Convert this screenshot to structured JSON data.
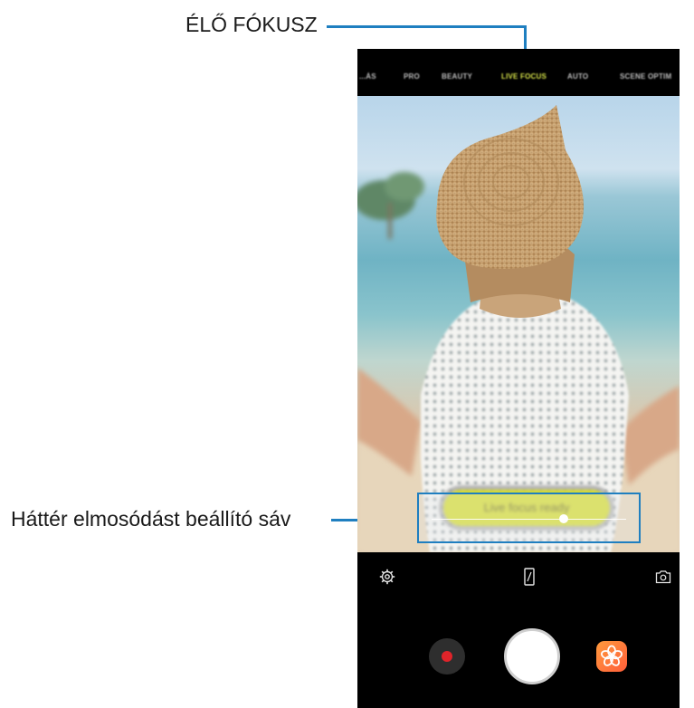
{
  "callouts": {
    "live_focus": "ÉLŐ FÓKUSZ",
    "blur_bar": "Háttér elmosódást beállító sáv"
  },
  "camera": {
    "modes": [
      {
        "label": "...ÁS",
        "active": false
      },
      {
        "label": "PRO",
        "active": false
      },
      {
        "label": "BEAUTY",
        "active": false
      },
      {
        "label": "LIVE FOCUS",
        "active": true
      },
      {
        "label": "AUTO",
        "active": false
      },
      {
        "label": "SCENE OPTIM",
        "active": false
      }
    ],
    "live_focus_status": "Live focus ready",
    "blur_level": 0.68,
    "icons": {
      "settings": "gear-icon",
      "aspect": "aspect-ratio-icon",
      "switch_camera": "switch-camera-icon",
      "record": "record-icon",
      "shutter": "shutter-icon",
      "effects": "flower-effects-icon"
    },
    "colors": {
      "callout_line": "#1f7fc0",
      "active_mode": "#d8e44a",
      "record": "#e0242a",
      "effects": "#ff7a3a",
      "toast": "#d6dd2c"
    }
  }
}
